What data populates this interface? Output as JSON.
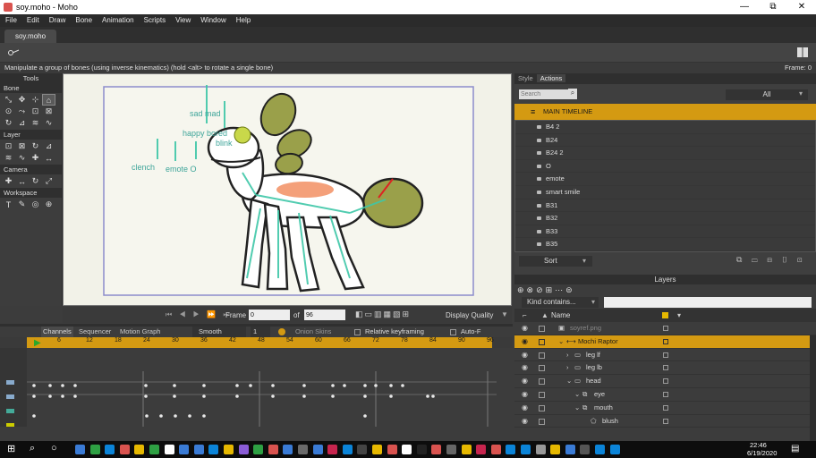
{
  "window": {
    "title": "soy.moho - Moho",
    "minimize": "—",
    "maximize": "⧉",
    "close": "✕"
  },
  "menu": [
    "File",
    "Edit",
    "Draw",
    "Bone",
    "Animation",
    "Scripts",
    "View",
    "Window",
    "Help"
  ],
  "doc_tab": "soy.moho",
  "status": {
    "hint": "Manipulate a group of bones (using inverse kinematics) (hold <alt> to rotate a single bone)",
    "frame": "Frame: 0"
  },
  "tools": {
    "header": "Tools",
    "sections": [
      {
        "name": "Bone",
        "icons": [
          "select-bone",
          "transform-bone",
          "add-bone",
          "reparent-bone",
          "bone-strength",
          "manipulate-bones",
          "bind-layer",
          "bind-points",
          "offset-bone",
          "pin-bone",
          "bone-physics",
          "bone-dynamics"
        ]
      },
      {
        "name": "Layer",
        "icons": [
          "set-origin",
          "translate-layer",
          "rotate-layer",
          "scale-layer",
          "shear-layer",
          "flip-layer",
          "text-tool",
          "eyedropper"
        ]
      },
      {
        "name": "Camera",
        "icons": [
          "track-camera",
          "zoom-camera",
          "roll-camera",
          "pan-tilt-camera"
        ]
      },
      {
        "name": "Workspace",
        "icons": [
          "hand",
          "zoom",
          "rotate-workspace",
          "orbit-workspace"
        ]
      }
    ]
  },
  "canvas_labels": [
    {
      "text": "sad mad"
    },
    {
      "text": "happy bored"
    },
    {
      "text": "blink"
    },
    {
      "text": "clench"
    },
    {
      "text": "emote O"
    }
  ],
  "viewctl": {
    "frame_label": "Frame",
    "frame_value": "0",
    "of_label": "of",
    "total_frames": "96",
    "display_quality": "Display Quality"
  },
  "style_actions": {
    "tabs": [
      "Style",
      "Actions"
    ],
    "search_placeholder": "Search",
    "filter": "All",
    "main_timeline": "MAIN TIMELINE",
    "actions": [
      "B4 2",
      "B24",
      "B24 2",
      "O",
      "emote",
      "smart smile",
      "B31",
      "B32",
      "B33",
      "B35"
    ],
    "sort_label": "Sort"
  },
  "layers": {
    "header": "Layers",
    "filter": "Kind contains...",
    "col_name": "Name",
    "rows": [
      {
        "name": "soyref.png",
        "indent": 0,
        "kind": "image",
        "selected": false,
        "dim": true
      },
      {
        "name": "Mochi Raptor",
        "indent": 1,
        "kind": "bone",
        "selected": true
      },
      {
        "name": "leg lf",
        "indent": 2,
        "kind": "group",
        "selected": false
      },
      {
        "name": "leg lb",
        "indent": 2,
        "kind": "group",
        "selected": false
      },
      {
        "name": "head",
        "indent": 2,
        "kind": "group",
        "selected": false
      },
      {
        "name": "eye",
        "indent": 3,
        "kind": "switch",
        "selected": false
      },
      {
        "name": "mouth",
        "indent": 3,
        "kind": "switch",
        "selected": false
      },
      {
        "name": "blush",
        "indent": 4,
        "kind": "vector",
        "selected": false
      }
    ]
  },
  "timeline": {
    "tabs": [
      "Channels",
      "Sequencer",
      "Motion Graph"
    ],
    "interp": "Smooth",
    "interp_count": "1",
    "onion": "Onion Skins",
    "relative": "Relative keyframing",
    "autofreeze": "Auto-F",
    "ruler": [
      "6",
      "12",
      "18",
      "24",
      "30",
      "36",
      "42",
      "48",
      "54",
      "60",
      "66",
      "72",
      "78",
      "84",
      "90",
      "96"
    ]
  },
  "taskbar": {
    "time": "22:46",
    "date": "6/19/2020"
  }
}
